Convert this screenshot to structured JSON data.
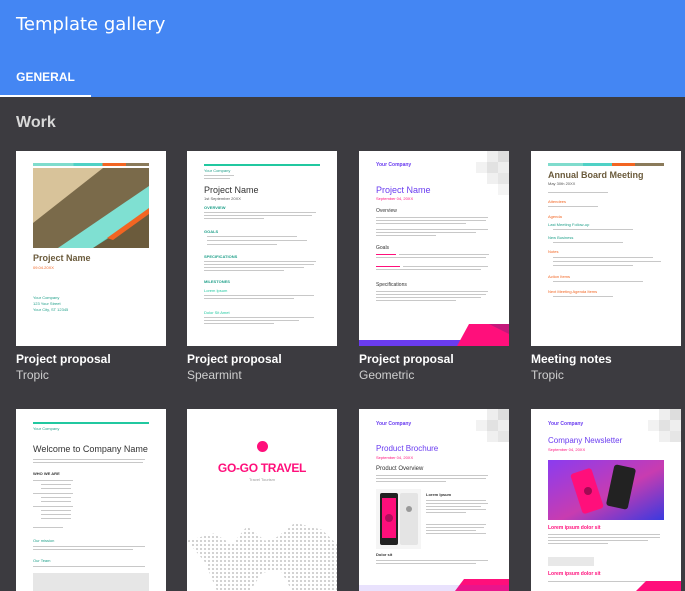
{
  "app": {
    "title": "Template gallery"
  },
  "tabs": [
    {
      "label": "GENERAL"
    }
  ],
  "section": {
    "title": "Work"
  },
  "colors": {
    "header": "#4486f3",
    "background": "#3c3b40",
    "spearmint": "#21c8a0",
    "geometric": "#6a3cf0",
    "pink": "#ff0f7b",
    "orange": "#f26522"
  },
  "templates": [
    {
      "name": "Project proposal",
      "theme": "Tropic",
      "thumb": {
        "title": "Project Name",
        "date": "09.04.20XX",
        "company": "Your Company",
        "address1": "123 Your Street",
        "address2": "Your City, ST 12345"
      }
    },
    {
      "name": "Project proposal",
      "theme": "Spearmint",
      "thumb": {
        "company": "Your Company",
        "title": "Project Name",
        "date": "1st September 20XX",
        "h1": "OVERVIEW",
        "h2": "GOALS",
        "h3": "SPECIFICATIONS",
        "h4": "MILESTONES",
        "h5": "Lorem Ipsum",
        "h6": "Dolor Sit Amet"
      }
    },
    {
      "name": "Project proposal",
      "theme": "Geometric",
      "thumb": {
        "company": "Your Company",
        "title": "Project Name",
        "date": "September 04, 20XX",
        "h1": "Overview",
        "h2": "Goals",
        "h3": "Specifications"
      }
    },
    {
      "name": "Meeting notes",
      "theme": "Tropic",
      "thumb": {
        "title": "Annual Board Meeting",
        "date": "May 30th 20XX",
        "h1": "Attendees",
        "h2": "Agenda",
        "h3": "Last Meeting Follow-up",
        "h4": "New Business",
        "h5": "Notes",
        "h6": "Action Items",
        "h7": "Next Meeting Agenda Items"
      }
    },
    {
      "thumb": {
        "company": "Your Company",
        "title": "Welcome to Company Name",
        "h1": "WHO WE ARE",
        "h2": "Our mission",
        "h3": "Our Team"
      }
    },
    {
      "thumb": {
        "logo": "GO-GO TRAVEL",
        "tagline": "Travel Tourism"
      }
    },
    {
      "thumb": {
        "company": "Your Company",
        "title": "Product Brochure",
        "date": "September 04, 20XX",
        "h1": "Product Overview",
        "h2": "Lorem Ipsum",
        "h3": "Dolor sit"
      }
    },
    {
      "thumb": {
        "company": "Your Company",
        "title": "Company Newsletter",
        "date": "September 04, 20XX",
        "h1": "Lorem ipsum dolor sit",
        "h2": "Lorem ipsum dolor sit"
      }
    }
  ]
}
